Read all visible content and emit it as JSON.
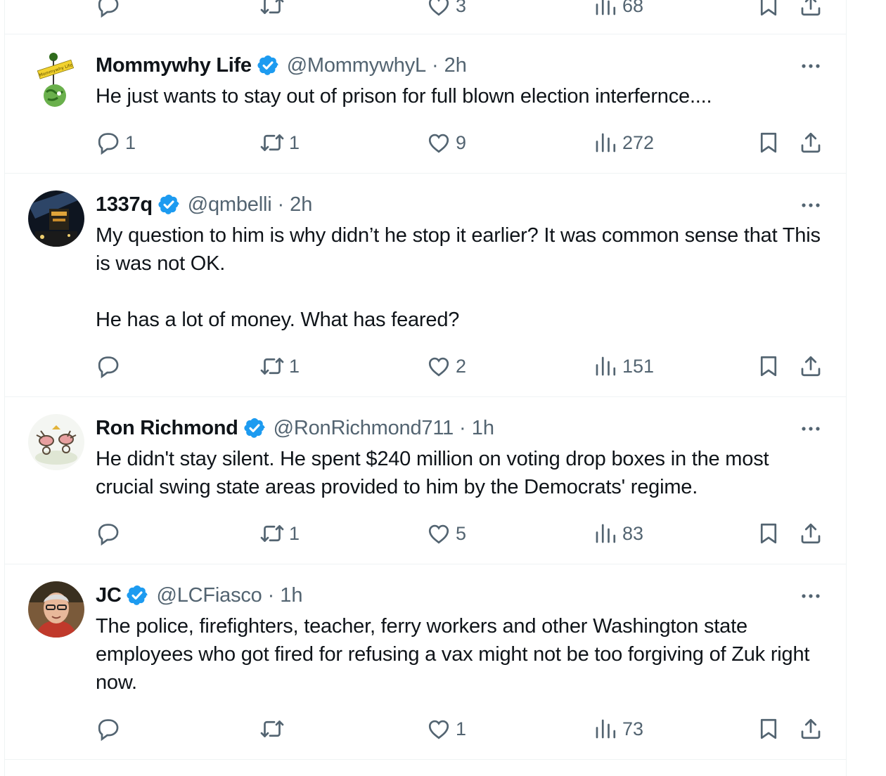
{
  "top_row": {
    "like_count": "3",
    "view_count": "68"
  },
  "posts": [
    {
      "name": "Mommywhy Life",
      "handle": "@MommywhyL",
      "time": "2h",
      "text": "He just wants to stay out of prison for full blown election interfernce....",
      "replies": "1",
      "reposts": "1",
      "likes": "9",
      "views": "272",
      "avatar_sign_text": "Mommywhy Life"
    },
    {
      "name": "1337q",
      "handle": "@qmbelli",
      "time": "2h",
      "text": "My question to him is why didn’t he stop it earlier? It was common sense that This is was not OK.\n\nHe has a lot of money. What has feared?",
      "replies": "",
      "reposts": "1",
      "likes": "2",
      "views": "151"
    },
    {
      "name": "Ron Richmond",
      "handle": "@RonRichmond711",
      "time": "1h",
      "text": "He didn't stay silent. He spent $240 million on voting drop boxes in the most crucial swing state areas provided to him by the Democrats' regime.",
      "replies": "",
      "reposts": "1",
      "likes": "5",
      "views": "83"
    },
    {
      "name": "JC",
      "handle": "@LCFiasco",
      "time": "1h",
      "text": "The police, firefighters, teacher, ferry workers and other Washington state employees who got fired for refusing a vax might not be too forgiving of Zuk right now.",
      "replies": "",
      "reposts": "",
      "likes": "1",
      "views": "73"
    }
  ],
  "colors": {
    "text": "#0f1419",
    "secondary": "#536471",
    "verified": "#1d9bf0",
    "divider": "#eff3f4"
  }
}
